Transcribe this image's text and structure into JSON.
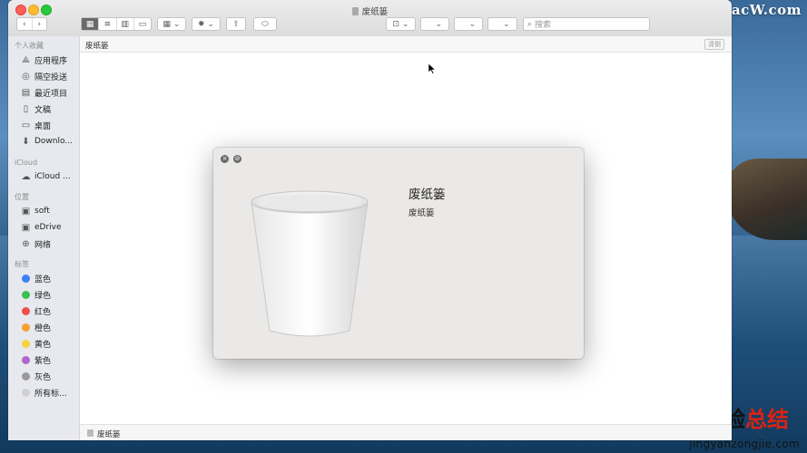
{
  "desktop": {
    "watermark": "www.MacW.com",
    "brand_black": "经验",
    "brand_red": "总结",
    "brand_sub": "jingyanzongjie.com"
  },
  "window": {
    "title": "废纸篓",
    "search_placeholder": "搜索",
    "path_label": "废纸篓",
    "clear_label": "清倒",
    "status_label": "废纸篓"
  },
  "sidebar": {
    "favorites_header": "个人收藏",
    "favorites": [
      {
        "label": "应用程序",
        "icon": "apps-icon"
      },
      {
        "label": "隔空投送",
        "icon": "airdrop-icon"
      },
      {
        "label": "最近项目",
        "icon": "recents-icon"
      },
      {
        "label": "文稿",
        "icon": "document-icon"
      },
      {
        "label": "桌面",
        "icon": "desktop-icon"
      },
      {
        "label": "Downlo...",
        "icon": "downloads-icon"
      }
    ],
    "icloud_header": "iCloud",
    "icloud": [
      {
        "label": "iCloud ...",
        "icon": "cloud-icon"
      }
    ],
    "locations_header": "位置",
    "locations": [
      {
        "label": "soft",
        "icon": "disk-icon"
      },
      {
        "label": "eDrive",
        "icon": "disk-icon"
      },
      {
        "label": "网络",
        "icon": "network-icon"
      }
    ],
    "tags_header": "标签",
    "tags": [
      {
        "label": "蓝色",
        "color": "#3b82f6"
      },
      {
        "label": "绿色",
        "color": "#3fbf4f"
      },
      {
        "label": "红色",
        "color": "#f0504a"
      },
      {
        "label": "橙色",
        "color": "#f5a033"
      },
      {
        "label": "黄色",
        "color": "#f6d33f"
      },
      {
        "label": "紫色",
        "color": "#b166cc"
      },
      {
        "label": "灰色",
        "color": "#9a9a9a"
      },
      {
        "label": "所有标...",
        "color": "#d0d0d0"
      }
    ]
  },
  "info_panel": {
    "name": "废纸篓",
    "kind": "废纸篓"
  }
}
